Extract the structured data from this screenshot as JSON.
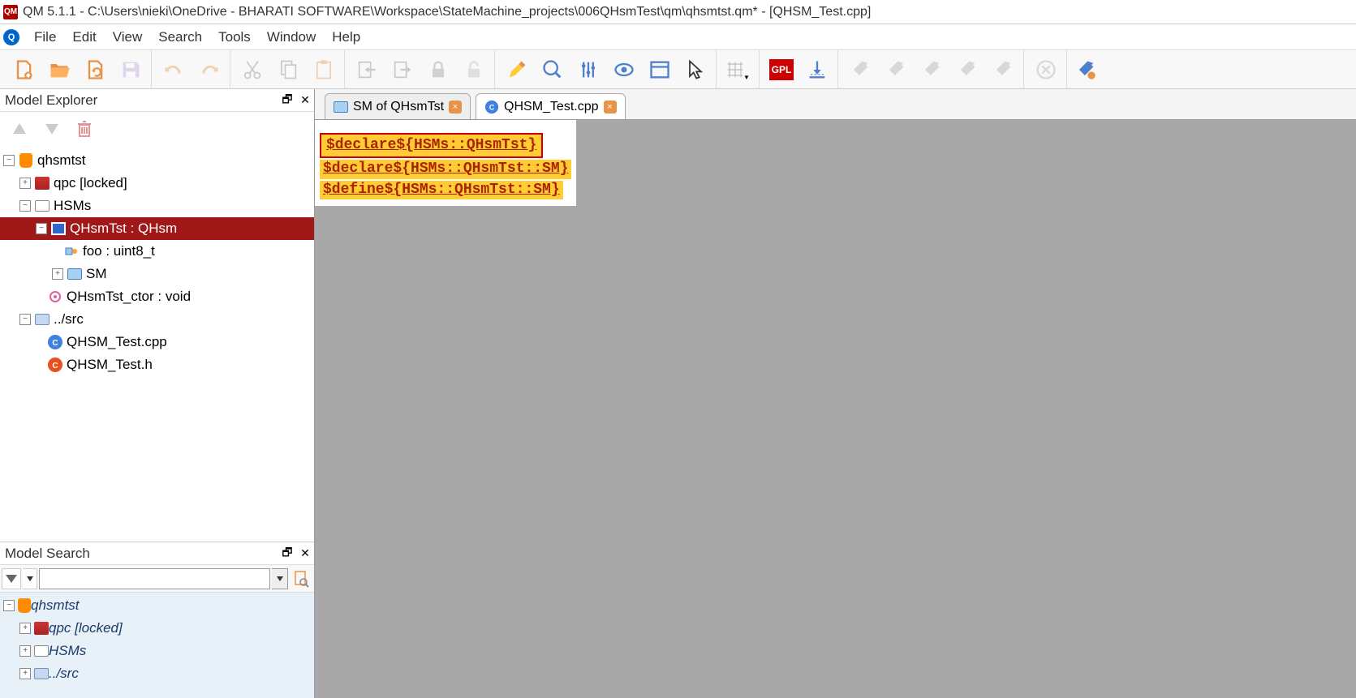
{
  "window": {
    "title": "QM 5.1.1 - C:\\Users\\nieki\\OneDrive - BHARATI SOFTWARE\\Workspace\\StateMachine_projects\\006QHsmTest\\qm\\qhsmtst.qm* - [QHSM_Test.cpp]"
  },
  "menu": {
    "items": [
      "File",
      "Edit",
      "View",
      "Search",
      "Tools",
      "Window",
      "Help"
    ]
  },
  "panels": {
    "explorer_title": "Model Explorer",
    "search_title": "Model Search"
  },
  "tree": {
    "root": "qhsmtst",
    "qpc": "qpc [locked]",
    "hsms": "HSMs",
    "qhsmtst_class": "QHsmTst : QHsm",
    "foo": "foo : uint8_t",
    "sm": "SM",
    "ctor": "QHsmTst_ctor : void",
    "src": "../src",
    "cpp": "QHSM_Test.cpp",
    "h": "QHSM_Test.h"
  },
  "search_results": {
    "root": "qhsmtst",
    "qpc": "qpc [locked]",
    "hsms": "HSMs",
    "src": "../src"
  },
  "tabs": {
    "sm": "SM of QHsmTst",
    "cpp": "QHSM_Test.cpp"
  },
  "code": {
    "line1": "$declare${HSMs::QHsmTst}",
    "line2": "$declare${HSMs::QHsmTst::SM}",
    "line3": "$define${HSMs::QHsmTst::SM}"
  },
  "search_input": ""
}
